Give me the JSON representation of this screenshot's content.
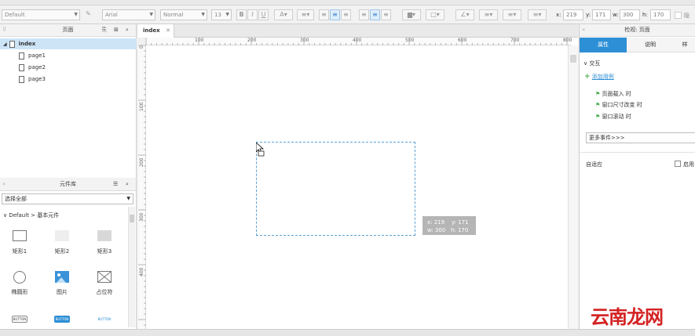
{
  "toolbar": {
    "style_select": "Default",
    "font_select": "Arial",
    "weight_select": "Normal",
    "size_select": "13",
    "bold": "B",
    "italic": "I",
    "underline": "U",
    "x_label": "x:",
    "x_value": "219",
    "y_label": "y:",
    "y_value": "171",
    "w_label": "w:",
    "w_value": "300",
    "h_label": "h:",
    "h_value": "170",
    "hide_label": "隐"
  },
  "pages_panel": {
    "title": "页面",
    "items": [
      {
        "label": "index",
        "selected": true
      },
      {
        "label": "page1"
      },
      {
        "label": "page2"
      },
      {
        "label": "page3"
      }
    ]
  },
  "library_panel": {
    "title": "元件库",
    "select_value": "选择全部",
    "group_label": "Default > 基本元件",
    "widgets": [
      {
        "label": "矩形1"
      },
      {
        "label": "矩形2"
      },
      {
        "label": "矩形3"
      },
      {
        "label": "椭圆形"
      },
      {
        "label": "图片"
      },
      {
        "label": "占位符"
      }
    ],
    "button_widgets": [
      "BUTTON",
      "BUTTON",
      "BUTTON"
    ]
  },
  "canvas": {
    "tab_label": "index",
    "ruler_h": [
      "100",
      "200",
      "300",
      "400",
      "500",
      "600",
      "700",
      "800"
    ],
    "ruler_v": [
      "0",
      "100",
      "200",
      "300",
      "400"
    ],
    "tooltip_line1": "x: 219    y: 171",
    "tooltip_line2": "w: 300   h: 170"
  },
  "inspector": {
    "title": "检视: 页面",
    "tabs": [
      "属性",
      "说明",
      "样"
    ],
    "section": "交互",
    "add_case": "添加用例",
    "events": [
      "页面载入 时",
      "窗口尺寸改变 时",
      "窗口滚动 时"
    ],
    "more_events": "更多事件>>>",
    "adaptive_label": "自适应",
    "enable_label": "启用"
  },
  "watermark": "云南龙网",
  "colors": {
    "accent": "#2d8fd5",
    "selection": "#cde4f7",
    "watermark": "#d42222"
  }
}
